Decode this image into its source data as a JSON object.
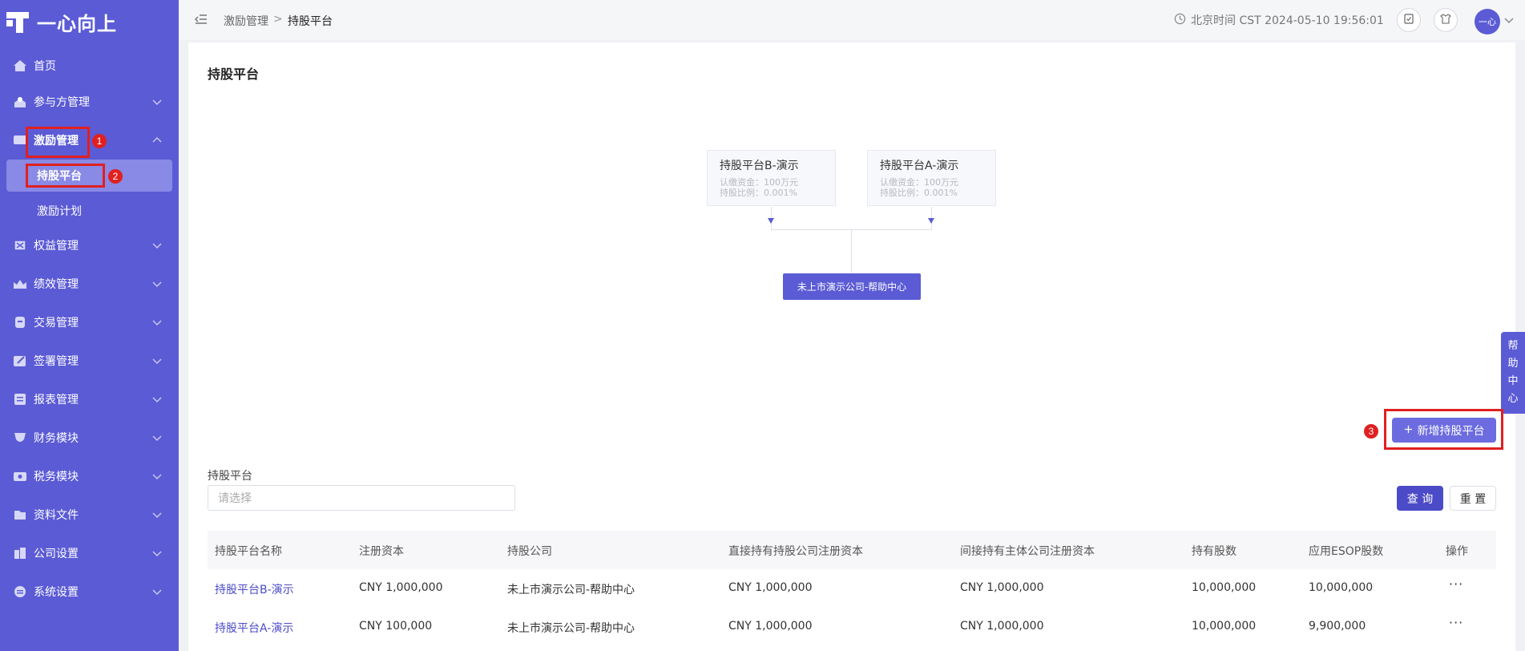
{
  "app": {
    "brand": "一心向上",
    "accent": "#5b5bd6",
    "annotation_color": "#e02020"
  },
  "sidebar": {
    "items": [
      {
        "label": "首页",
        "icon": "home-icon",
        "expandable": false
      },
      {
        "label": "参与方管理",
        "icon": "participants-icon",
        "expandable": true
      },
      {
        "label": "激励管理",
        "icon": "incentive-icon",
        "expandable": true,
        "expanded": true,
        "children": [
          {
            "label": "持股平台",
            "active": true
          },
          {
            "label": "激励计划",
            "active": false
          }
        ]
      },
      {
        "label": "权益管理",
        "icon": "equity-icon",
        "expandable": true
      },
      {
        "label": "绩效管理",
        "icon": "performance-icon",
        "expandable": true
      },
      {
        "label": "交易管理",
        "icon": "trade-icon",
        "expandable": true
      },
      {
        "label": "签署管理",
        "icon": "sign-icon",
        "expandable": true
      },
      {
        "label": "报表管理",
        "icon": "report-icon",
        "expandable": true
      },
      {
        "label": "财务模块",
        "icon": "finance-icon",
        "expandable": true
      },
      {
        "label": "税务模块",
        "icon": "tax-icon",
        "expandable": true
      },
      {
        "label": "资料文件",
        "icon": "files-icon",
        "expandable": true
      },
      {
        "label": "公司设置",
        "icon": "company-settings-icon",
        "expandable": true
      },
      {
        "label": "系统设置",
        "icon": "system-settings-icon",
        "expandable": true
      }
    ]
  },
  "annotations": [
    "1",
    "2",
    "3"
  ],
  "header": {
    "breadcrumb": {
      "parent": "激励管理",
      "separator": ">",
      "current": "持股平台"
    },
    "clock": "北京时间 CST 2024-05-10 19:56:01",
    "avatar_text": "一心"
  },
  "main": {
    "title": "持股平台",
    "org_chart": {
      "platforms": [
        {
          "name": "持股平台B-演示",
          "capital": "认缴资金：100万元",
          "ratio": "持股比例：0.001%"
        },
        {
          "name": "持股平台A-演示",
          "capital": "认缴资金：100万元",
          "ratio": "持股比例：0.001%"
        }
      ],
      "root": "未上市演示公司-帮助中心"
    },
    "add_button": "新增持股平台",
    "help_tab": [
      "帮",
      "助",
      "中",
      "心"
    ],
    "filter": {
      "label": "持股平台",
      "placeholder": "请选择"
    },
    "query_button": "查 询",
    "reset_button": "重 置",
    "table": {
      "columns": [
        "持股平台名称",
        "注册资本",
        "持股公司",
        "直接持有持股公司注册资本",
        "间接持有主体公司注册资本",
        "持有股数",
        "应用ESOP股数",
        "操作"
      ],
      "rows": [
        [
          "持股平台B-演示",
          "CNY 1,000,000",
          "未上市演示公司-帮助中心",
          "CNY 1,000,000",
          "CNY 1,000,000",
          "10,000,000",
          "10,000,000",
          "···"
        ],
        [
          "持股平台A-演示",
          "CNY 100,000",
          "未上市演示公司-帮助中心",
          "CNY 1,000,000",
          "CNY 1,000,000",
          "10,000,000",
          "9,900,000",
          "···"
        ]
      ]
    }
  }
}
